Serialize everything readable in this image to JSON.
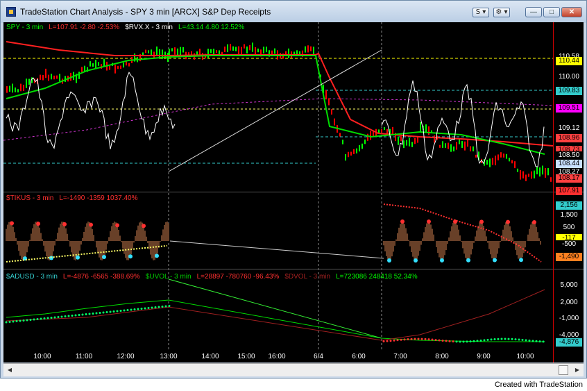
{
  "window": {
    "title": "TradeStation Chart Analysis - SPY 3 min [ARCX] S&P Dep Receipts",
    "s_button": "S",
    "settings_button": "⚙",
    "minimize": "—",
    "maximize": "□",
    "close": "✕"
  },
  "panes": {
    "price": {
      "legend": [
        {
          "text": "SPY - 3 min",
          "color": "#00ff00"
        },
        {
          "text": "L=107.91  -2.80  -2.53%",
          "color": "#ff3030"
        },
        {
          "text": "$RVX.X - 3 min",
          "color": "#ffffff"
        },
        {
          "text": "L=43.14  4.80  12.52%",
          "color": "#00ff00"
        }
      ],
      "right_labels": [
        {
          "text": "110.58",
          "bg": "#000000",
          "fg": "#ffffff"
        },
        {
          "text": "110.44",
          "bg": "#ffff00",
          "fg": "#000000"
        },
        {
          "text": "110.00",
          "bg": "#000000",
          "fg": "#ffffff"
        },
        {
          "text": "109.83",
          "bg": "#33cccc",
          "fg": "#000000"
        },
        {
          "text": "109.51",
          "bg": "#ff00ff",
          "fg": "#000000"
        },
        {
          "text": "109.12",
          "bg": "#000000",
          "fg": "#ffffff"
        },
        {
          "text": "108.96",
          "bg": "#ff4040",
          "fg": "#000000"
        },
        {
          "text": "108.73",
          "bg": "#ff4040",
          "fg": "#000000"
        },
        {
          "text": "108.50",
          "bg": "#000000",
          "fg": "#ffffff"
        },
        {
          "text": "108.44",
          "bg": "#c8e0ff",
          "fg": "#000000"
        },
        {
          "text": "108.27",
          "bg": "#000000",
          "fg": "#ffffff"
        },
        {
          "text": "108.17",
          "bg": "#ff4040",
          "fg": "#000000"
        },
        {
          "text": "107.91",
          "bg": "#ff3030",
          "fg": "#000000"
        }
      ]
    },
    "tikus": {
      "legend": [
        {
          "text": "$TIKUS - 3 min",
          "color": "#ff3030"
        },
        {
          "text": "L=-1490  -1359  1037.40%",
          "color": "#ff3030"
        }
      ],
      "right_labels": [
        {
          "text": "2,156",
          "bg": "#33cccc",
          "fg": "#000000"
        },
        {
          "text": "1,500",
          "bg": "#000000",
          "fg": "#ffffff"
        },
        {
          "text": "500",
          "bg": "#000000",
          "fg": "#ffffff"
        },
        {
          "text": "-117",
          "bg": "#ffff00",
          "fg": "#000000"
        },
        {
          "text": "-500",
          "bg": "#000000",
          "fg": "#ffffff"
        },
        {
          "text": "-1,490",
          "bg": "#ff8020",
          "fg": "#000000"
        }
      ]
    },
    "adusd": {
      "legend": [
        {
          "text": "$ADUSD - 3 min",
          "color": "#33cccc"
        },
        {
          "text": "L=-4876  -6565  -388.69%",
          "color": "#ff3030"
        },
        {
          "text": "$UVOL - 3 min",
          "color": "#00cc00"
        },
        {
          "text": "L=28897  -780760  -96.43%",
          "color": "#ff3030"
        },
        {
          "text": "$DVOL - 3 min",
          "color": "#a02020"
        },
        {
          "text": "L=723086  248418  52.34%",
          "color": "#00ff00"
        }
      ],
      "right_labels": [
        {
          "text": "5,000",
          "bg": "#000000",
          "fg": "#ffffff"
        },
        {
          "text": "2,000",
          "bg": "#000000",
          "fg": "#ffffff"
        },
        {
          "text": "-1,000",
          "bg": "#000000",
          "fg": "#ffffff"
        },
        {
          "text": "-4,000",
          "bg": "#000000",
          "fg": "#ffffff"
        },
        {
          "text": "-4,876",
          "bg": "#33cccc",
          "fg": "#000000"
        }
      ]
    }
  },
  "time_axis": [
    "10:00",
    "11:00",
    "12:00",
    "13:00",
    "14:00",
    "15:00",
    "16:00",
    "6/4",
    "6:00",
    "7:00",
    "8:00",
    "9:00",
    "10:00"
  ],
  "footer": "Created with TradeStation",
  "colors": {
    "background": "#000000",
    "up_bar": "#00ff00",
    "down_bar": "#ff0000",
    "ma_red": "#ff2020",
    "ma_green": "#00dd00"
  }
}
